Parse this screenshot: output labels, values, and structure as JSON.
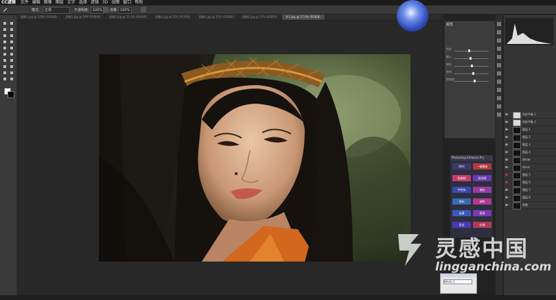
{
  "app": {
    "logo_text": "CC滤镜",
    "menu": [
      "文件",
      "编辑",
      "图像",
      "图层",
      "文字",
      "选择",
      "滤镜",
      "3D",
      "视图",
      "窗口",
      "帮助"
    ]
  },
  "options_bar": {
    "mode_label": "模式:",
    "mode_value": "正常",
    "opacity_label": "不透明度:",
    "opacity_value": "100%",
    "flow_label": "流量:",
    "flow_value": "100%"
  },
  "tabs": [
    {
      "label": "图像1.jpg @ 100% (RGB/8)",
      "active": false
    },
    {
      "label": "图像2.jpg @ 50% (RGB/8)",
      "active": false
    },
    {
      "label": "图像3.jpg @ 33.3% (RGB/8)",
      "active": false
    },
    {
      "label": "图像4.jpg @ 25% (RGB/8)",
      "active": false
    },
    {
      "label": "图像5.jpg @ 25% (RGB/8)",
      "active": false
    },
    {
      "label": "图像6.jpg @ 25% (RGB/8)",
      "active": false
    },
    {
      "label": "8-1.jpg @ 17.4% (RGB/8)",
      "active": true
    }
  ],
  "properties_panel": {
    "title": "属性",
    "sliders": [
      "色阶",
      "输入",
      "输出",
      "曲线",
      "饱和度"
    ]
  },
  "plugin_panel": {
    "title": "Photoshop Enhance Pro",
    "buttons": [
      {
        "label": "DR3",
        "color": "#3a3a6a"
      },
      {
        "label": "一键磨皮",
        "color": "#b03a3a"
      },
      {
        "label": "双曲线",
        "color": "#c23d6a"
      },
      {
        "label": "高低频",
        "color": "#6a3ab0"
      },
      {
        "label": "中性灰",
        "color": "#3a4ab0"
      },
      {
        "label": "液化",
        "color": "#9a3aa0"
      },
      {
        "label": "锐化",
        "color": "#3a6ab0"
      },
      {
        "label": "调色",
        "color": "#b03a8a"
      },
      {
        "label": "去黄",
        "color": "#3a5ab8"
      },
      {
        "label": "提亮",
        "color": "#7a3ab0"
      },
      {
        "label": "导出",
        "color": "#4a3ab0"
      },
      {
        "label": "存储",
        "color": "#b03a5a"
      }
    ]
  },
  "layers": [
    {
      "name": "色彩平衡 1",
      "thumb": "w",
      "red": false
    },
    {
      "name": "色彩平衡 2",
      "thumb": "w",
      "red": false
    },
    {
      "name": "图层 1",
      "thumb": "d",
      "red": false
    },
    {
      "name": "图层 2",
      "thumb": "d",
      "red": false
    },
    {
      "name": "图层 3",
      "thumb": "d",
      "red": false
    },
    {
      "name": "图层 4",
      "thumb": "d",
      "red": false
    },
    {
      "name": "White",
      "thumb": "d",
      "red": false
    },
    {
      "name": "Black",
      "thumb": "d",
      "red": false
    },
    {
      "name": "图层 5",
      "thumb": "d",
      "red": true
    },
    {
      "name": "图层 6",
      "thumb": "d",
      "red": true
    },
    {
      "name": "图层 7",
      "thumb": "d",
      "red": false
    },
    {
      "name": "图层 8",
      "thumb": "d",
      "red": false
    },
    {
      "name": "背景",
      "thumb": "d",
      "red": false
    }
  ],
  "mini_dialog": {
    "value": "White 3"
  },
  "watermark": {
    "brand_cn": "灵感中国",
    "url": "lingganchina.com"
  }
}
